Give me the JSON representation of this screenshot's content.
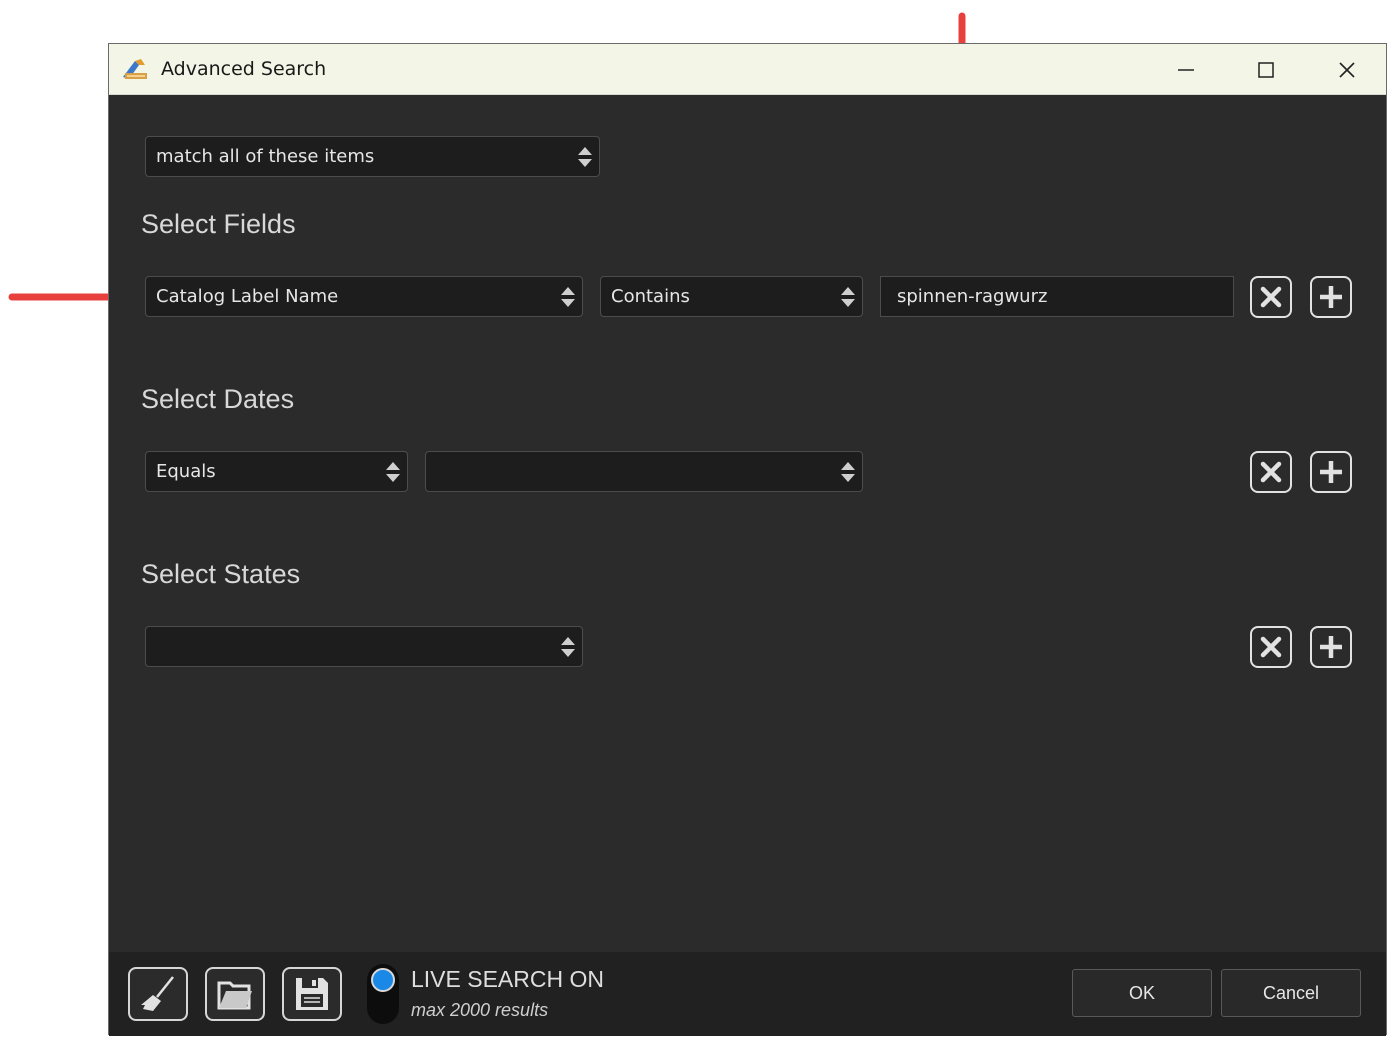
{
  "window": {
    "title": "Advanced Search",
    "controls": [
      "minimize-icon",
      "maximize-icon",
      "close-icon"
    ]
  },
  "match": {
    "value": "match all of these items"
  },
  "fields": {
    "heading": "Select Fields",
    "field_select": "Catalog Label Name",
    "operator_select": "Contains",
    "value": "spinnen-ragwurz"
  },
  "dates": {
    "heading": "Select Dates",
    "operator_select": "Equals",
    "date_select": ""
  },
  "states": {
    "heading": "Select States",
    "state_select": ""
  },
  "bottom": {
    "tools": [
      "broom-icon",
      "folder-icon",
      "save-icon"
    ],
    "live_search": "LIVE SEARCH ON",
    "live_search_sub": "max 2000 results",
    "ok_label": "OK",
    "cancel_label": "Cancel"
  },
  "colors": {
    "window_bg": "#2c2b2c",
    "titlebar_bg": "#f3f5e6",
    "annotation_arrow": "#e8413d",
    "toggle_accent": "#1a88e6"
  }
}
